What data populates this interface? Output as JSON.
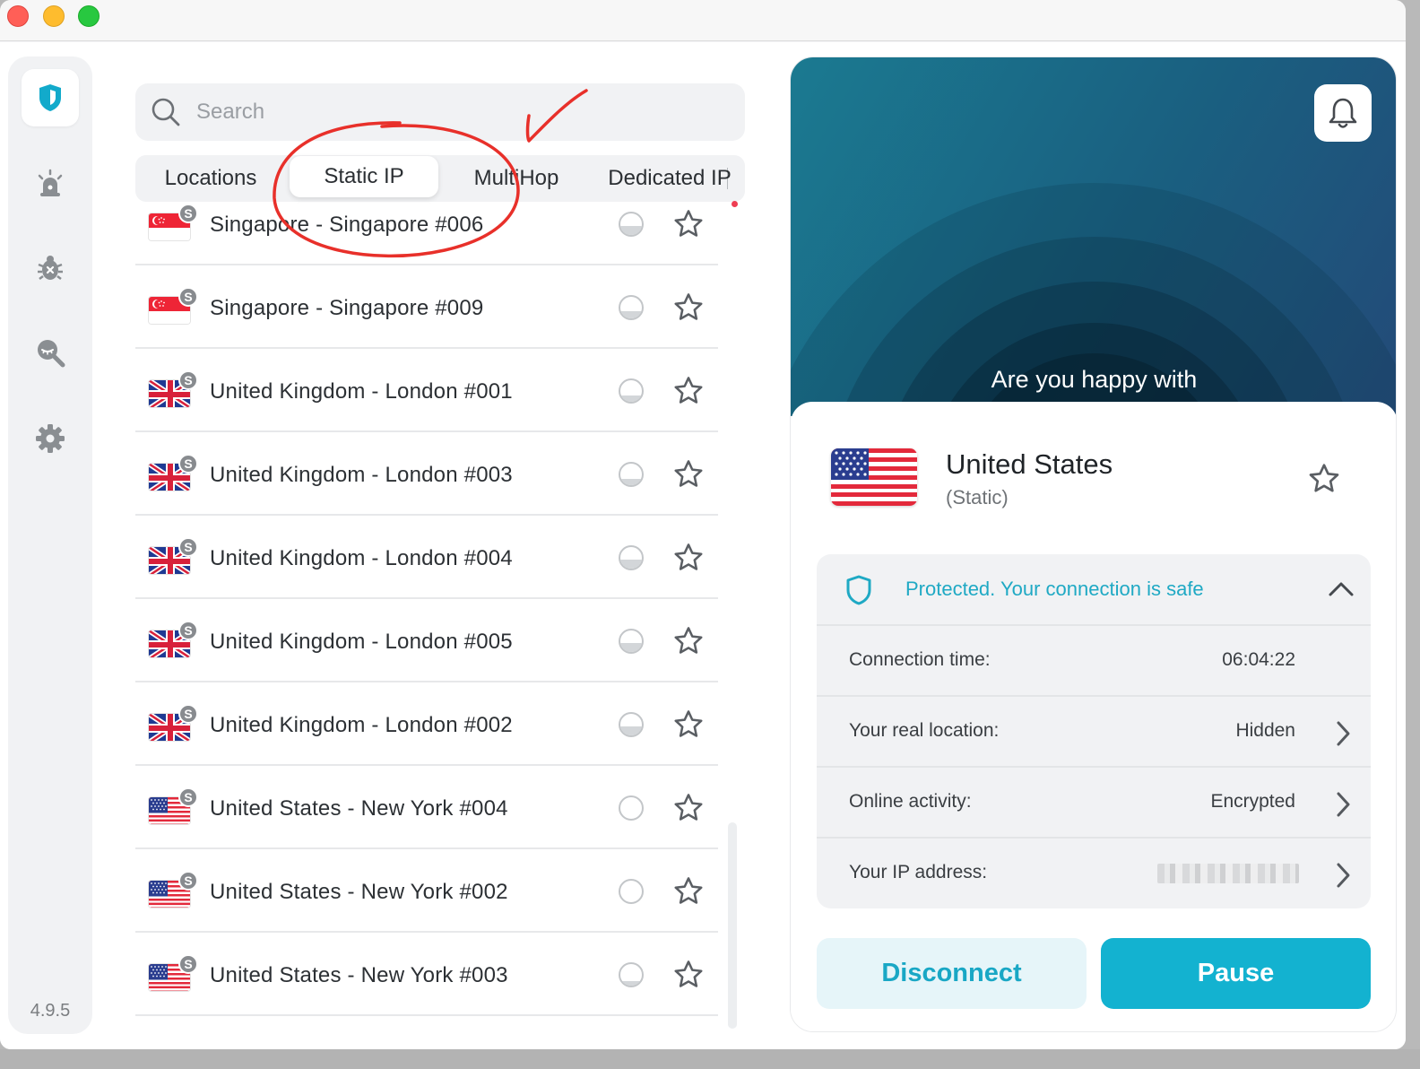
{
  "app": {
    "version": "4.9.5"
  },
  "sidebar": {
    "items": [
      {
        "name": "shield",
        "active": true
      },
      {
        "name": "alert"
      },
      {
        "name": "bug"
      },
      {
        "name": "search-privacy"
      },
      {
        "name": "settings"
      }
    ]
  },
  "search": {
    "placeholder": "Search",
    "value": ""
  },
  "tabs": [
    {
      "label": "Locations",
      "active": false
    },
    {
      "label": "Static IP",
      "active": true
    },
    {
      "label": "MultiHop",
      "active": false
    },
    {
      "label": "Dedicated IP",
      "active": false,
      "notification_dot": true
    }
  ],
  "servers": [
    {
      "name": "Singapore - Singapore #006",
      "flag": "sg",
      "badge": "S",
      "load": 0.4
    },
    {
      "name": "Singapore - Singapore #009",
      "flag": "sg",
      "badge": "S",
      "load": 0.35
    },
    {
      "name": "United Kingdom - London #001",
      "flag": "uk",
      "badge": "S",
      "load": 0.3
    },
    {
      "name": "United Kingdom - London #003",
      "flag": "uk",
      "badge": "S",
      "load": 0.3
    },
    {
      "name": "United Kingdom - London #004",
      "flag": "uk",
      "badge": "S",
      "load": 0.4
    },
    {
      "name": "United Kingdom - London #005",
      "flag": "uk",
      "badge": "S",
      "load": 0.4
    },
    {
      "name": "United Kingdom - London #002",
      "flag": "uk",
      "badge": "S",
      "load": 0.4
    },
    {
      "name": "United States - New York #004",
      "flag": "us",
      "badge": "S",
      "load": 0.0
    },
    {
      "name": "United States - New York #002",
      "flag": "us",
      "badge": "S",
      "load": 0.0
    },
    {
      "name": "United States - New York #003",
      "flag": "us",
      "badge": "S",
      "load": 0.2
    }
  ],
  "connection": {
    "banner_text": "Are you happy with",
    "country": "United States",
    "type": "(Static)",
    "status": "Protected. Your connection is safe",
    "details": [
      {
        "label": "Connection time:",
        "value": "06:04:22",
        "has_arrow": false
      },
      {
        "label": "Your real location:",
        "value": "Hidden",
        "has_arrow": true
      },
      {
        "label": "Online activity:",
        "value": "Encrypted",
        "has_arrow": true
      },
      {
        "label": "Your IP address:",
        "value": "",
        "has_arrow": true,
        "blurred": true
      }
    ],
    "disconnect_label": "Disconnect",
    "pause_label": "Pause"
  },
  "colors": {
    "accent": "#13b2d0",
    "status_text": "#1fa9c4",
    "annotation": "#e8302a"
  }
}
